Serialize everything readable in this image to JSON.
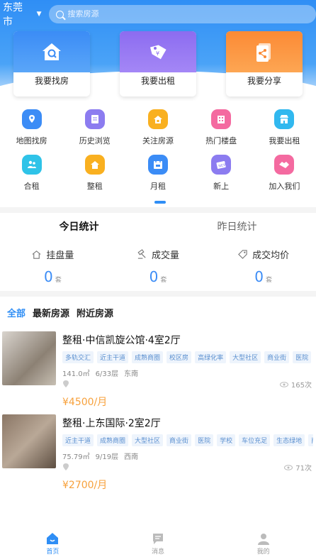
{
  "header": {
    "city": "东莞市",
    "search_placeholder": "搜索房源"
  },
  "cards": [
    {
      "label": "我要找房",
      "icon": "house-search-icon"
    },
    {
      "label": "我要出租",
      "icon": "price-tag-icon"
    },
    {
      "label": "我要分享",
      "icon": "share-icon"
    }
  ],
  "grid": [
    {
      "label": "地图找房",
      "icon": "map-icon",
      "color": "#3b8cf6"
    },
    {
      "label": "历史浏览",
      "icon": "history-icon",
      "color": "#8c7cf0"
    },
    {
      "label": "关注房源",
      "icon": "favorite-house-icon",
      "color": "#f9b020"
    },
    {
      "label": "热门楼盘",
      "icon": "building-icon",
      "color": "#f46aa0"
    },
    {
      "label": "我要出租",
      "icon": "store-icon",
      "color": "#31b8ef"
    },
    {
      "label": "合租",
      "icon": "people-icon",
      "color": "#2fc3e8"
    },
    {
      "label": "整租",
      "icon": "home-icon",
      "color": "#f9b020"
    },
    {
      "label": "月租",
      "icon": "calendar-icon",
      "color": "#3b8cf6"
    },
    {
      "label": "新上",
      "icon": "new-badge-icon",
      "color": "#8c7cf0"
    },
    {
      "label": "加入我们",
      "icon": "handshake-icon",
      "color": "#f46aa0"
    }
  ],
  "stats_tabs": {
    "today": "今日统计",
    "yesterday": "昨日统计"
  },
  "stats": [
    {
      "label": "挂盘量",
      "value": "0",
      "unit": "套",
      "icon": "house-outline-icon"
    },
    {
      "label": "成交量",
      "value": "0",
      "unit": "套",
      "icon": "hammer-icon"
    },
    {
      "label": "成交均价",
      "value": "0",
      "unit": "套",
      "icon": "tag-outline-icon"
    }
  ],
  "filter_tabs": {
    "all": "全部",
    "latest": "最新房源",
    "nearby": "附近房源"
  },
  "listings": [
    {
      "title": "整租·中信凯旋公馆·4室2厅",
      "tags": [
        "多轨交汇",
        "近主干道",
        "成熟商圈",
        "校区房",
        "高绿化率",
        "大型社区",
        "商业街",
        "医院"
      ],
      "area": "141.0㎡",
      "floor": "6/33层",
      "orientation": "东南",
      "views": "165次",
      "price": "¥4500/月"
    },
    {
      "title": "整租·上东国际·2室2厅",
      "tags": [
        "近主干道",
        "成熟商圈",
        "大型社区",
        "商业街",
        "医院",
        "学校",
        "车位充足",
        "生态绿地",
        "商"
      ],
      "area": "75.79㎡",
      "floor": "9/19层",
      "orientation": "西南",
      "views": "71次",
      "price": "¥2700/月"
    }
  ],
  "tabbar": [
    {
      "label": "首页",
      "icon": "home-tab-icon"
    },
    {
      "label": "消息",
      "icon": "message-icon"
    },
    {
      "label": "我的",
      "icon": "profile-icon"
    }
  ],
  "colors": {
    "primary": "#2f8ef5",
    "price": "#f7a13c",
    "tag_text": "#5a8fcf",
    "tag_bg": "#eef4fc"
  }
}
